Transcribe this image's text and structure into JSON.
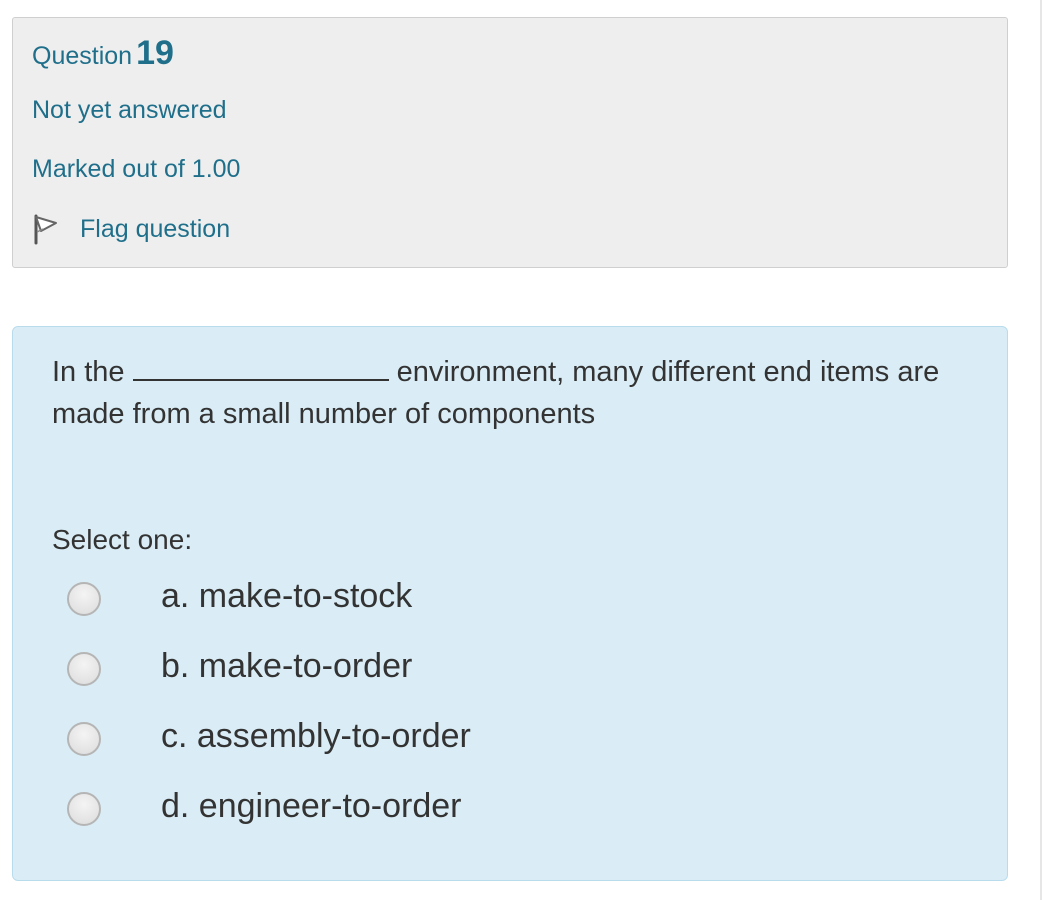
{
  "question_info": {
    "title_prefix": "Question",
    "number": "19",
    "state": "Not yet answered",
    "grade": "Marked out of 1.00",
    "flag": {
      "icon": "flag-icon",
      "label": "Flag question"
    }
  },
  "question": {
    "text_before_blank": "In the",
    "text_after_blank": "environment, many different end items are made from a small number of components",
    "prompt": "Select one:",
    "options": [
      {
        "label": "a. make-to-stock",
        "selected": false
      },
      {
        "label": "b. make-to-order",
        "selected": false
      },
      {
        "label": "c. assembly-to-order",
        "selected": false
      },
      {
        "label": "d. engineer-to-order",
        "selected": false
      }
    ]
  },
  "colors": {
    "info_text": "#1f6f8b",
    "info_background": "#eeeeee",
    "content_background": "#daedf6",
    "content_text": "#333333"
  }
}
